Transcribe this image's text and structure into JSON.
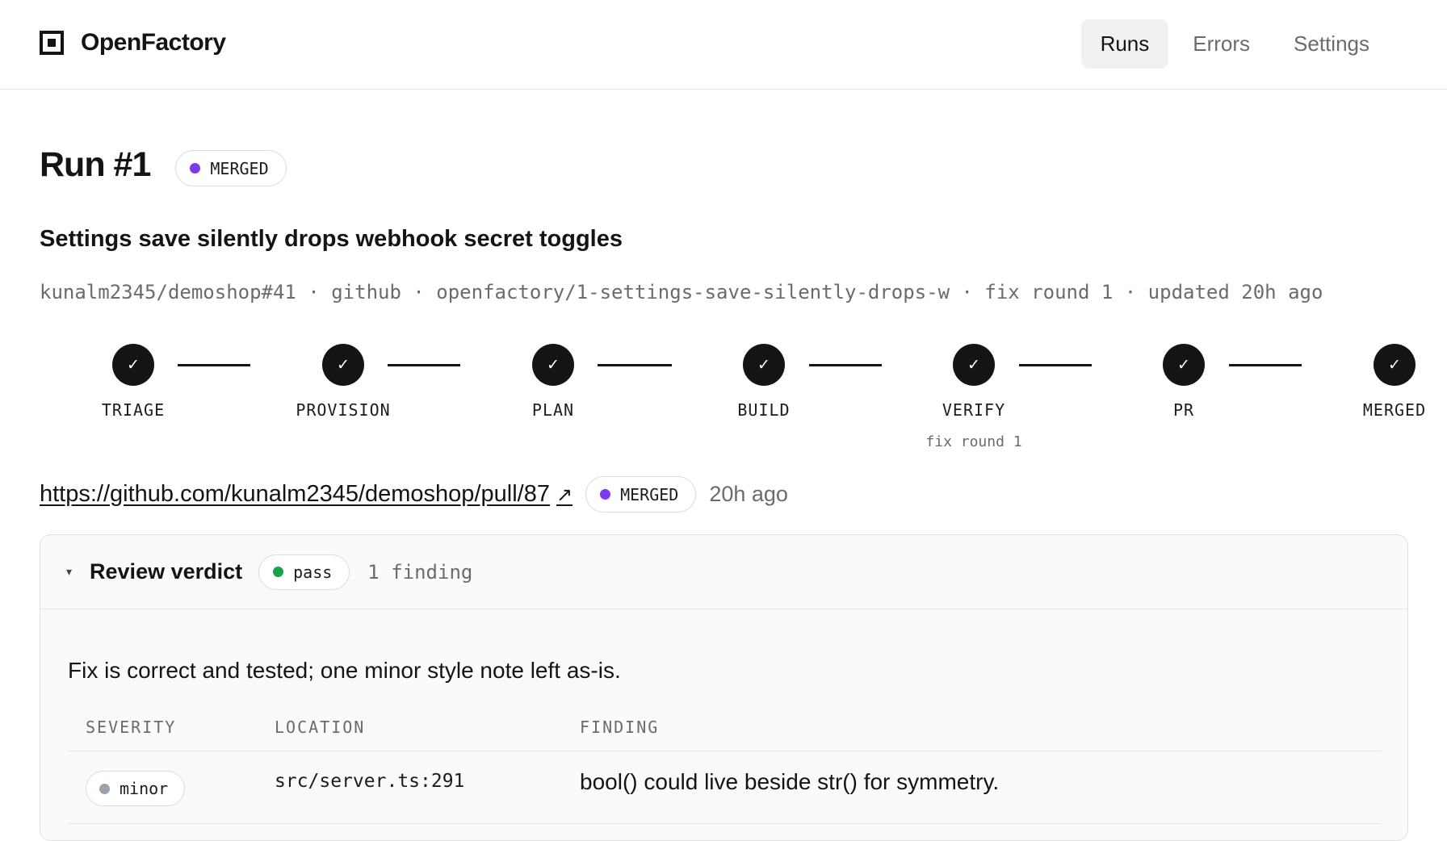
{
  "app": {
    "name": "OpenFactory",
    "logo_icon": "square-logo-icon"
  },
  "nav": {
    "items": [
      {
        "label": "Runs",
        "active": true
      },
      {
        "label": "Errors",
        "active": false
      },
      {
        "label": "Settings",
        "active": false
      }
    ]
  },
  "run": {
    "title": "Run #1",
    "status": {
      "label": "MERGED",
      "color": "#7c3aed"
    },
    "subtitle": "Settings save silently drops webhook secret toggles",
    "meta": "kunalm2345/demoshop#41 · github · openfactory/1-settings-save-silently-drops-w · fix round 1 · updated 20h ago"
  },
  "stepper": {
    "steps": [
      {
        "label": "TRIAGE",
        "done": true,
        "icon": "check-icon",
        "sub": ""
      },
      {
        "label": "PROVISION",
        "done": true,
        "icon": "check-icon",
        "sub": ""
      },
      {
        "label": "PLAN",
        "done": true,
        "icon": "check-icon",
        "sub": ""
      },
      {
        "label": "BUILD",
        "done": true,
        "icon": "check-icon",
        "sub": ""
      },
      {
        "label": "VERIFY",
        "done": true,
        "icon": "check-icon",
        "sub": "fix round 1"
      },
      {
        "label": "PR",
        "done": true,
        "icon": "check-icon",
        "sub": ""
      },
      {
        "label": "MERGED",
        "done": true,
        "icon": "check-icon",
        "sub": ""
      }
    ],
    "check_glyph": "✓"
  },
  "pr": {
    "url": "https://github.com/kunalm2345/demoshop/pull/87",
    "external_icon": "↗",
    "status": {
      "label": "MERGED",
      "color": "#7c3aed"
    },
    "time": "20h ago"
  },
  "review": {
    "title": "Review verdict",
    "caret": "▾",
    "verdict": {
      "label": "pass",
      "color": "#16a34a"
    },
    "finding_count": "1 finding",
    "summary": "Fix is correct and tested; one minor style note left as-is.",
    "columns": [
      "SEVERITY",
      "LOCATION",
      "FINDING"
    ],
    "rows": [
      {
        "severity": "minor",
        "severity_color": "#9ca3af",
        "location": "src/server.ts:291",
        "finding": "bool() could live beside str() for symmetry."
      }
    ]
  }
}
